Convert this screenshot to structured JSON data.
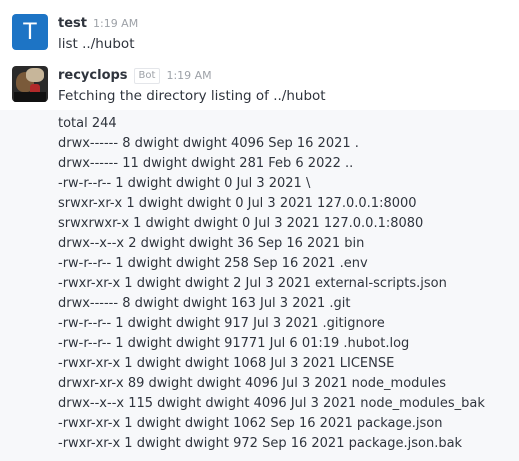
{
  "partial_top_text": "…",
  "messages": [
    {
      "avatar_letter": "T",
      "username": "test",
      "time": "1:19 AM",
      "text": "list ../hubot"
    },
    {
      "username": "recyclops",
      "badge": "Bot",
      "time": "1:19 AM",
      "text": "Fetching the directory listing of ../hubot"
    }
  ],
  "listing": [
    "total 244",
    "drwx------ 8 dwight dwight 4096 Sep 16 2021 .",
    "drwx------ 11 dwight dwight 281 Feb 6 2022 ..",
    "-rw-r--r-- 1 dwight dwight 0 Jul 3 2021 \\",
    "srwxr-xr-x 1 dwight dwight 0 Jul 3 2021 127.0.0.1:8000",
    "srwxrwxr-x 1 dwight dwight 0 Jul 3 2021 127.0.0.1:8080",
    "drwx--x--x 2 dwight dwight 36 Sep 16 2021 bin",
    "-rw-r--r-- 1 dwight dwight 258 Sep 16 2021 .env",
    "-rwxr-xr-x 1 dwight dwight 2 Jul 3 2021 external-scripts.json",
    "drwx------ 8 dwight dwight 163 Jul 3 2021 .git",
    "-rw-r--r-- 1 dwight dwight 917 Jul 3 2021 .gitignore",
    "-rw-r--r-- 1 dwight dwight 91771 Jul 6 01:19 .hubot.log",
    "-rwxr-xr-x 1 dwight dwight 1068 Jul 3 2021 LICENSE",
    "drwxr-xr-x 89 dwight dwight 4096 Jul 3 2021 node_modules",
    "drwx--x--x 115 dwight dwight 4096 Jul 3 2021 node_modules_bak",
    "-rwxr-xr-x 1 dwight dwight 1062 Sep 16 2021 package.json",
    "-rwxr-xr-x 1 dwight dwight 972 Sep 16 2021 package.json.bak"
  ]
}
